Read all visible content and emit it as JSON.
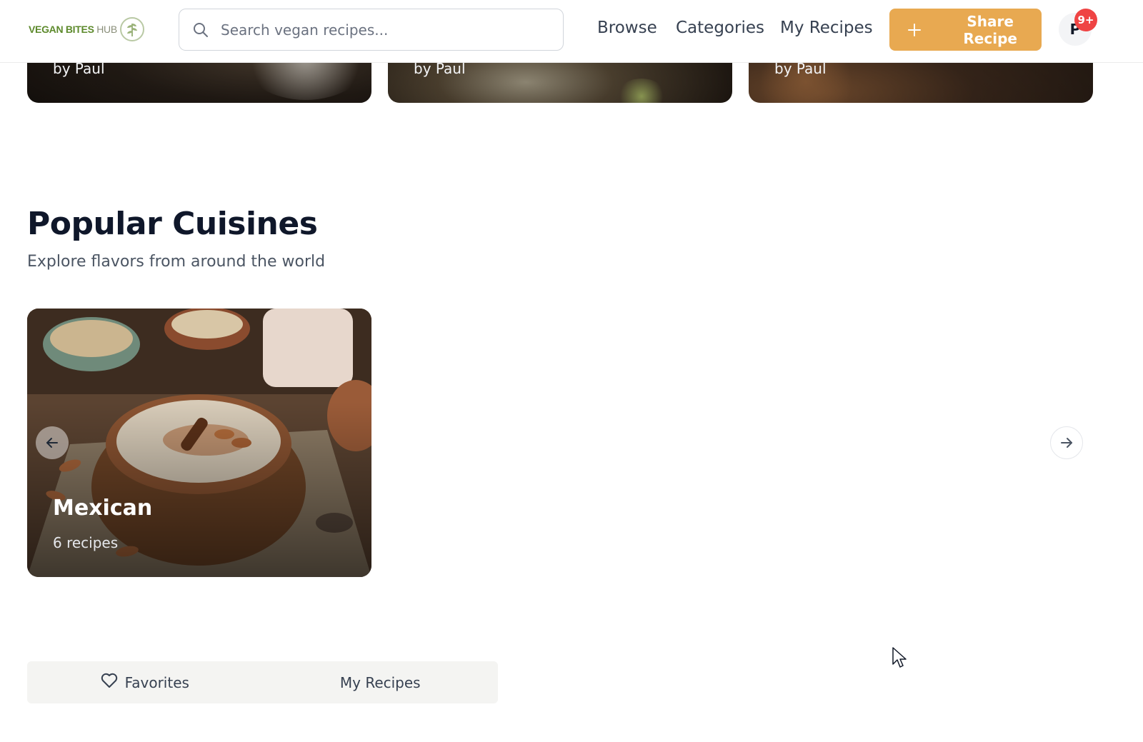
{
  "header": {
    "logo": {
      "part1": "VEGAN BITES",
      "part2": "HUB"
    },
    "search": {
      "placeholder": "Search vegan recipes..."
    },
    "nav": [
      {
        "label": "Browse"
      },
      {
        "label": "Categories"
      },
      {
        "label": "My Recipes"
      }
    ],
    "share_button": {
      "label": "Share Recipe"
    },
    "avatar": {
      "initial": "P",
      "notification_badge": "9+"
    }
  },
  "recipe_cards_partial": [
    {
      "author": "by Paul"
    },
    {
      "author": "by Paul"
    },
    {
      "author": "by Paul"
    }
  ],
  "popular_cuisines": {
    "title": "Popular Cuisines",
    "subtitle": "Explore flavors from around the world",
    "cards": [
      {
        "name": "Mexican",
        "count": "6 recipes"
      }
    ]
  },
  "tabs": [
    {
      "label": "Favorites",
      "icon": "heart-icon"
    },
    {
      "label": "My Recipes"
    }
  ],
  "colors": {
    "accent": "#e8a951",
    "badge": "#ef4444",
    "logo_green": "#5d8a2c",
    "heading": "#0f172a"
  }
}
